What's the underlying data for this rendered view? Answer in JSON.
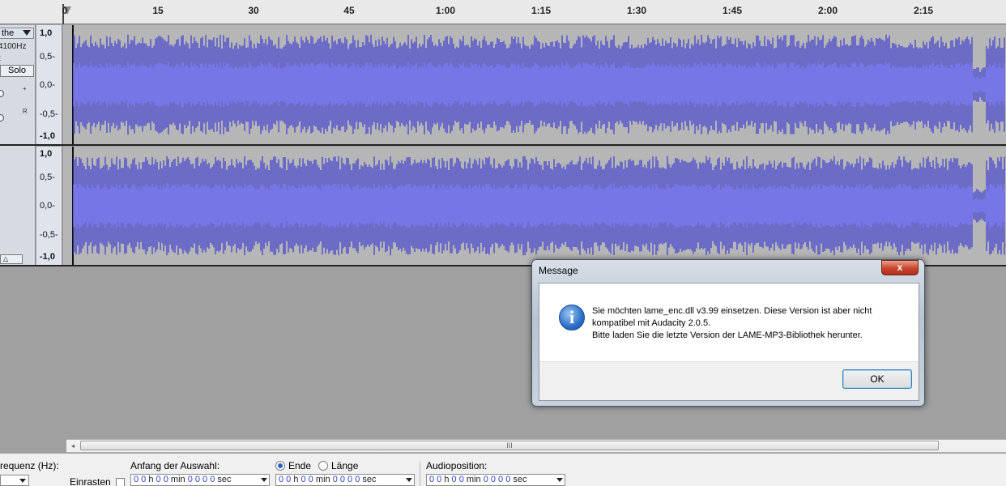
{
  "ruler": {
    "labels": [
      "0",
      "15",
      "30",
      "45",
      "1:00",
      "1:15",
      "1:30",
      "1:45",
      "2:00",
      "2:15"
    ]
  },
  "track": {
    "name": "the",
    "rate": "4100Hz",
    "format": "t",
    "solo_label": "Solo",
    "pan_plus": "+",
    "pan_right": "R",
    "collapse_glyph": "△",
    "scale": [
      "1,0",
      "0,5-",
      "0,0-",
      "-0,5-",
      "-1,0"
    ]
  },
  "dialog": {
    "title": "Message",
    "close_label": "x",
    "icon_glyph": "i",
    "message_line1": "Sie möchten lame_enc.dll v3.99 einsetzen. Diese Version ist aber nicht",
    "message_line2": "kompatibel mit Audacity 2.0.5.",
    "message_line3": "Bitte laden Sie die letzte Version der LAME-MP3-Bibliothek herunter.",
    "ok_label": "OK"
  },
  "scrollbar": {
    "left_glyph": "◂",
    "grip": "III"
  },
  "selection_toolbar": {
    "rate_label": "requenz (Hz):",
    "snap_label": "Einrasten",
    "start_label": "Anfang der Auswahl:",
    "end_label": "Ende",
    "length_label": "Länge",
    "end_selected": true,
    "audio_position_label": "Audioposition:",
    "start_time": {
      "h": "0 0",
      "min": "0 0",
      "sec": "0 0 0 0"
    },
    "end_time": {
      "h": "0 0",
      "min": "0 0",
      "sec": "0 0 0 0"
    },
    "audio_time": {
      "h": "0 0",
      "min": "0 0",
      "sec": "0 0 0 0"
    },
    "units": {
      "h": "h",
      "min": "min",
      "sec": "sec"
    }
  },
  "colors": {
    "waveform_outer": "#3b3bd1",
    "waveform_rms": "#6c6cf2",
    "waveform_background": "#b6b6b6"
  }
}
